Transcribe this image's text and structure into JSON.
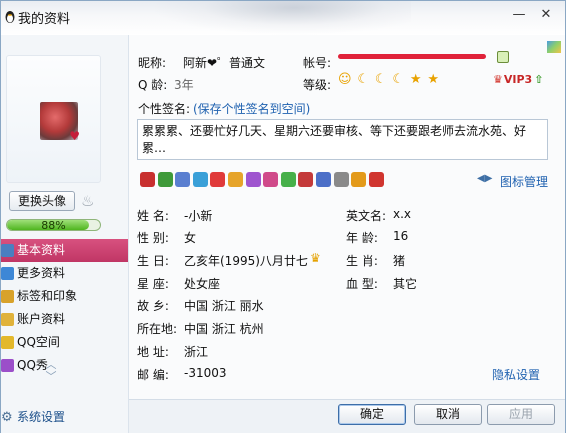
{
  "window": {
    "title": "我的资料",
    "controls": [
      "—",
      "✕"
    ]
  },
  "left": {
    "change_avatar_label": "更换头像",
    "completion_percent": 88,
    "completion_text": "88%",
    "nav": [
      {
        "label": "基本资料",
        "active": true,
        "icon": "profile-card-icon",
        "color": "#4a7fc0"
      },
      {
        "label": "更多资料",
        "active": false,
        "icon": "more-profile-icon",
        "color": "#3d87d6"
      },
      {
        "label": "标签和印象",
        "active": false,
        "icon": "tag-icon",
        "color": "#d8a22a"
      },
      {
        "label": "账户资料",
        "active": false,
        "icon": "account-icon",
        "color": "#e0b23a"
      },
      {
        "label": "QQ空间",
        "active": false,
        "icon": "qzone-icon",
        "color": "#e3b82b"
      },
      {
        "label": "QQ秀",
        "active": false,
        "icon": "qqshow-icon",
        "color": "#9b4fc9"
      }
    ],
    "scroll_up": "︿",
    "scroll_down": "﹀",
    "settings_label": "系统设置"
  },
  "profile": {
    "nickname_label": "昵称:",
    "nickname": "阿新❤゜普通文",
    "account_label": "帐号:",
    "qage_label": "Q 龄:",
    "qage": "3年",
    "level_label": "等级:",
    "level_icons": [
      "☺",
      "☾",
      "☾",
      "☾",
      "★",
      "★"
    ],
    "vip_text": "VIP3",
    "signature_label": "个性签名:",
    "signature_save_link": "(保存个性签名到空间)",
    "signature": "累累累、还要忙好几天、星期六还要审核、等下还要跟老师去流水苑、好累…",
    "icon_manage_link": "图标管理",
    "icon_strip_colors": [
      "#c8302f",
      "#3f9a3a",
      "#5a7fd0",
      "#3aa0d8",
      "#e03a3a",
      "#e6a42a",
      "#9f55cf",
      "#d04a8a",
      "#47b04a",
      "#c43a3a",
      "#4c6fc8",
      "#8a8a8a",
      "#e39a1a",
      "#d0352f"
    ],
    "strip_nav": "◀▶"
  },
  "details": {
    "name_label": "姓  名:",
    "name": "-小新",
    "english_name_label": "英文名:",
    "english_name": "x.x",
    "gender_label": "性  别:",
    "gender": "女",
    "age_label": "年  龄:",
    "age": "16",
    "birthday_label": "生  日:",
    "birthday": "乙亥年(1995)八月廿七",
    "zodiac_label": "生  肖:",
    "zodiac": "猪",
    "constellation_label": "星  座:",
    "constellation": "处女座",
    "blood_label": "血  型:",
    "blood": "其它",
    "hometown_label": "故  乡:",
    "hometown": "中国  浙江  丽水",
    "location_label": "所在地:",
    "location": "中国  浙江  杭州",
    "address_label": "地  址:",
    "address": "浙江",
    "postcode_label": "邮  编:",
    "postcode": "-31003",
    "privacy_link": "隐私设置"
  },
  "buttons": {
    "ok": "确定",
    "cancel": "取消",
    "apply": "应用"
  }
}
